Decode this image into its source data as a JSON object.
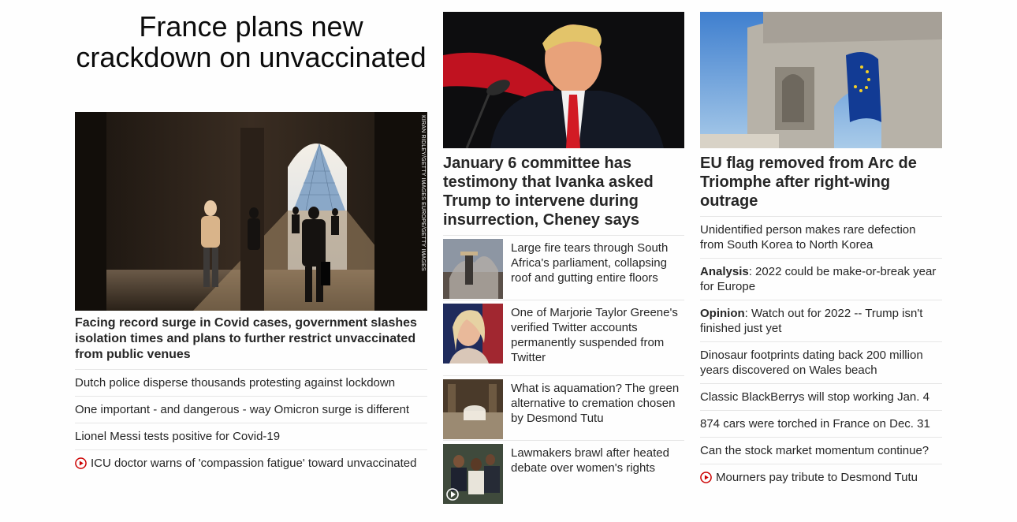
{
  "colors": {
    "accent": "#cc0000",
    "text": "#262626",
    "divider": "#e6e6e6"
  },
  "col1": {
    "headline": "France plans new crackdown on unvaccinated",
    "image_credit": "KIRAN RIDLEY/GETTY IMAGES EUROPE/GETTY IMAGES",
    "caption": "Facing record surge in Covid cases, government slashes isolation times and plans to further restrict unvaccinated from public venues",
    "links": [
      {
        "text": "Dutch police disperse thousands protesting against lockdown",
        "video": false
      },
      {
        "text": "One important - and dangerous - way Omicron surge is different",
        "video": false
      },
      {
        "text": "Lionel Messi tests positive for Covid-19",
        "video": false
      },
      {
        "text": "ICU doctor warns of 'compassion fatigue' toward unvaccinated",
        "video": true,
        "icon": "play-icon"
      }
    ]
  },
  "col2": {
    "headline": "January 6 committee has testimony that Ivanka asked Trump to intervene during insurrection, Cheney says",
    "stories": [
      {
        "text": "Large fire tears through South Africa's parliament, collapsing roof and gutting entire floors"
      },
      {
        "text": "One of Marjorie Taylor Greene's verified Twitter accounts permanently suspended from Twitter"
      },
      {
        "text": "What is aquamation? The green alternative to cremation chosen by Desmond Tutu"
      },
      {
        "text": "Lawmakers brawl after heated debate over women's rights",
        "video": true
      }
    ]
  },
  "col3": {
    "headline": "EU flag removed from Arc de Triomphe after right-wing outrage",
    "links": [
      {
        "prefix": "",
        "text": "Unidentified person makes rare defection from South Korea to North Korea"
      },
      {
        "prefix": "Analysis",
        "text": ": 2022 could be make-or-break year for Europe"
      },
      {
        "prefix": "Opinion",
        "text": ": Watch out for 2022 -- Trump isn't finished just yet"
      },
      {
        "prefix": "",
        "text": "Dinosaur footprints dating back 200 million years discovered on Wales beach"
      },
      {
        "prefix": "",
        "text": "Classic BlackBerrys will stop working Jan. 4"
      },
      {
        "prefix": "",
        "text": "874 cars were torched in France on Dec. 31"
      },
      {
        "prefix": "",
        "text": "Can the stock market momentum continue?"
      },
      {
        "prefix": "",
        "text": "Mourners pay tribute to Desmond Tutu",
        "video": true,
        "icon": "play-icon"
      }
    ]
  }
}
